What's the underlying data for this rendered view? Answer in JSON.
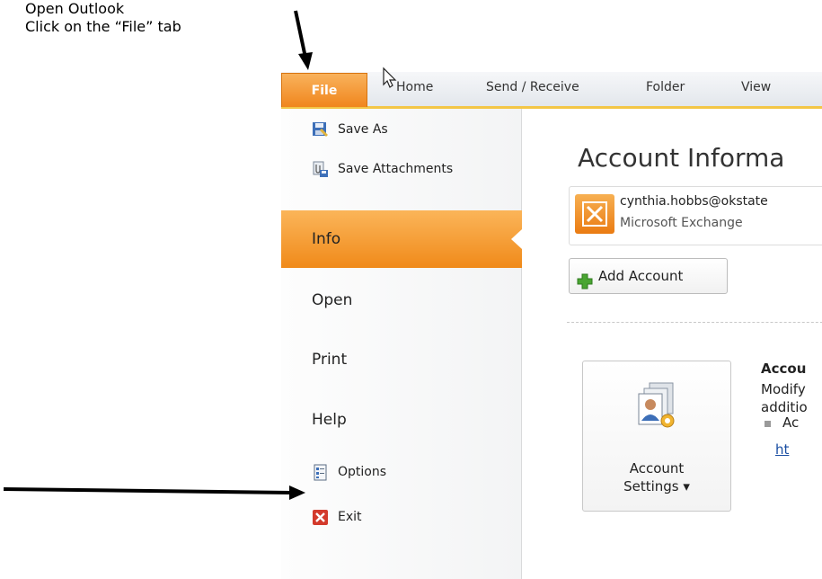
{
  "instructions": {
    "line1": "Open Outlook",
    "line2": "Click on the “File” tab"
  },
  "ribbon": {
    "tabs": [
      {
        "label": "File"
      },
      {
        "label": "Home"
      },
      {
        "label": "Send / Receive"
      },
      {
        "label": "Folder"
      },
      {
        "label": "View"
      }
    ],
    "active_tab_color": "#f08a1a",
    "accent_line_color": "#f3c646"
  },
  "backstage": {
    "commands_top": [
      {
        "label": "Save As",
        "icon": "save-as-icon"
      },
      {
        "label": "Save Attachments",
        "icon": "save-attachments-icon"
      }
    ],
    "nav": [
      {
        "label": "Info",
        "active": true
      },
      {
        "label": "Open"
      },
      {
        "label": "Print"
      },
      {
        "label": "Help"
      }
    ],
    "commands_bottom": [
      {
        "label": "Options",
        "icon": "options-icon"
      },
      {
        "label": "Exit",
        "icon": "exit-icon"
      }
    ]
  },
  "info": {
    "title": "Account Informa",
    "account": {
      "email": "cynthia.hobbs@okstate",
      "type": "Microsoft Exchange",
      "icon": "exchange-icon"
    },
    "add_account_label": "Add Account",
    "account_settings": {
      "label_line1": "Account",
      "label_line2": "Settings ▾",
      "section_title": "Accou",
      "desc_line1": "Modify",
      "desc_line2": "additio",
      "bullet_text": "Ac",
      "link_text": "ht"
    }
  }
}
